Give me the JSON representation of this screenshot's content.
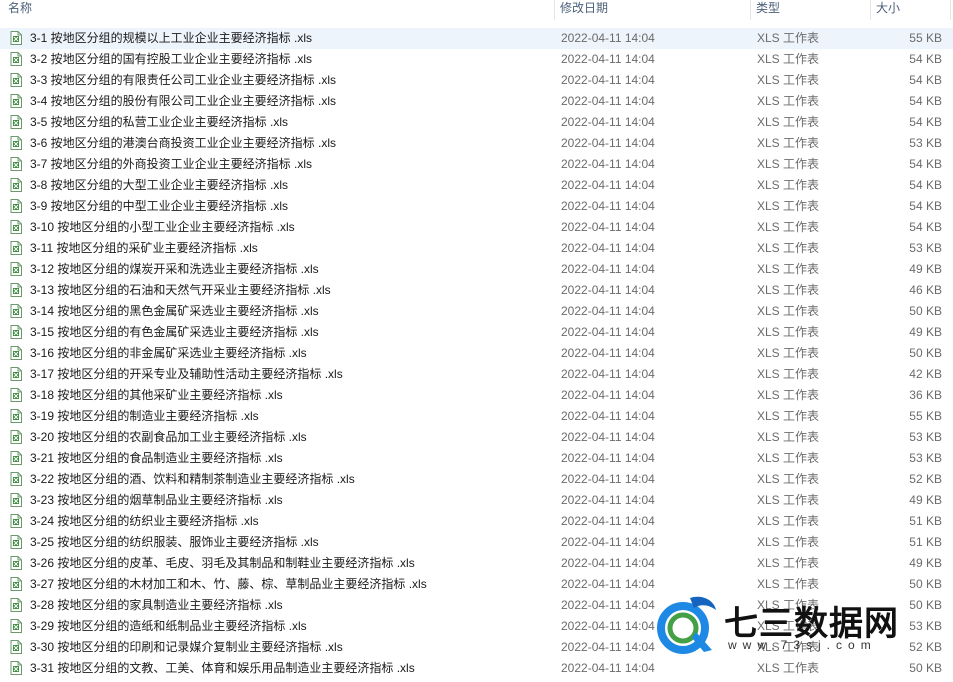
{
  "columns": {
    "name": "名称",
    "date": "修改日期",
    "type": "类型",
    "size": "大小"
  },
  "files": [
    {
      "name": "3-1 按地区分组的规模以上工业企业主要经济指标 .xls",
      "date": "2022-04-11 14:04",
      "type": "XLS 工作表",
      "size": "55 KB"
    },
    {
      "name": "3-2 按地区分组的国有控股工业企业主要经济指标 .xls",
      "date": "2022-04-11 14:04",
      "type": "XLS 工作表",
      "size": "54 KB"
    },
    {
      "name": "3-3 按地区分组的有限责任公司工业企业主要经济指标 .xls",
      "date": "2022-04-11 14:04",
      "type": "XLS 工作表",
      "size": "54 KB"
    },
    {
      "name": "3-4 按地区分组的股份有限公司工业企业主要经济指标 .xls",
      "date": "2022-04-11 14:04",
      "type": "XLS 工作表",
      "size": "54 KB"
    },
    {
      "name": "3-5 按地区分组的私营工业企业主要经济指标 .xls",
      "date": "2022-04-11 14:04",
      "type": "XLS 工作表",
      "size": "54 KB"
    },
    {
      "name": "3-6 按地区分组的港澳台商投资工业企业主要经济指标 .xls",
      "date": "2022-04-11 14:04",
      "type": "XLS 工作表",
      "size": "53 KB"
    },
    {
      "name": "3-7 按地区分组的外商投资工业企业主要经济指标 .xls",
      "date": "2022-04-11 14:04",
      "type": "XLS 工作表",
      "size": "54 KB"
    },
    {
      "name": "3-8 按地区分组的大型工业企业主要经济指标 .xls",
      "date": "2022-04-11 14:04",
      "type": "XLS 工作表",
      "size": "54 KB"
    },
    {
      "name": "3-9 按地区分组的中型工业企业主要经济指标 .xls",
      "date": "2022-04-11 14:04",
      "type": "XLS 工作表",
      "size": "54 KB"
    },
    {
      "name": "3-10 按地区分组的小型工业企业主要经济指标 .xls",
      "date": "2022-04-11 14:04",
      "type": "XLS 工作表",
      "size": "54 KB"
    },
    {
      "name": "3-11 按地区分组的采矿业主要经济指标 .xls",
      "date": "2022-04-11 14:04",
      "type": "XLS 工作表",
      "size": "53 KB"
    },
    {
      "name": "3-12 按地区分组的煤炭开采和洗选业主要经济指标 .xls",
      "date": "2022-04-11 14:04",
      "type": "XLS 工作表",
      "size": "49 KB"
    },
    {
      "name": "3-13 按地区分组的石油和天然气开采业主要经济指标 .xls",
      "date": "2022-04-11 14:04",
      "type": "XLS 工作表",
      "size": "46 KB"
    },
    {
      "name": "3-14 按地区分组的黑色金属矿采选业主要经济指标 .xls",
      "date": "2022-04-11 14:04",
      "type": "XLS 工作表",
      "size": "50 KB"
    },
    {
      "name": "3-15 按地区分组的有色金属矿采选业主要经济指标 .xls",
      "date": "2022-04-11 14:04",
      "type": "XLS 工作表",
      "size": "49 KB"
    },
    {
      "name": "3-16 按地区分组的非金属矿采选业主要经济指标 .xls",
      "date": "2022-04-11 14:04",
      "type": "XLS 工作表",
      "size": "50 KB"
    },
    {
      "name": "3-17 按地区分组的开采专业及辅助性活动主要经济指标 .xls",
      "date": "2022-04-11 14:04",
      "type": "XLS 工作表",
      "size": "42 KB"
    },
    {
      "name": "3-18 按地区分组的其他采矿业主要经济指标 .xls",
      "date": "2022-04-11 14:04",
      "type": "XLS 工作表",
      "size": "36 KB"
    },
    {
      "name": "3-19 按地区分组的制造业主要经济指标 .xls",
      "date": "2022-04-11 14:04",
      "type": "XLS 工作表",
      "size": "55 KB"
    },
    {
      "name": "3-20 按地区分组的农副食品加工业主要经济指标 .xls",
      "date": "2022-04-11 14:04",
      "type": "XLS 工作表",
      "size": "53 KB"
    },
    {
      "name": "3-21 按地区分组的食品制造业主要经济指标 .xls",
      "date": "2022-04-11 14:04",
      "type": "XLS 工作表",
      "size": "53 KB"
    },
    {
      "name": "3-22 按地区分组的酒、饮料和精制茶制造业主要经济指标 .xls",
      "date": "2022-04-11 14:04",
      "type": "XLS 工作表",
      "size": "52 KB"
    },
    {
      "name": "3-23 按地区分组的烟草制品业主要经济指标 .xls",
      "date": "2022-04-11 14:04",
      "type": "XLS 工作表",
      "size": "49 KB"
    },
    {
      "name": "3-24 按地区分组的纺织业主要经济指标 .xls",
      "date": "2022-04-11 14:04",
      "type": "XLS 工作表",
      "size": "51 KB"
    },
    {
      "name": "3-25 按地区分组的纺织服装、服饰业主要经济指标 .xls",
      "date": "2022-04-11 14:04",
      "type": "XLS 工作表",
      "size": "51 KB"
    },
    {
      "name": "3-26 按地区分组的皮革、毛皮、羽毛及其制品和制鞋业主要经济指标 .xls",
      "date": "2022-04-11 14:04",
      "type": "XLS 工作表",
      "size": "49 KB"
    },
    {
      "name": "3-27 按地区分组的木材加工和木、竹、藤、棕、草制品业主要经济指标 .xls",
      "date": "2022-04-11 14:04",
      "type": "XLS 工作表",
      "size": "50 KB"
    },
    {
      "name": "3-28 按地区分组的家具制造业主要经济指标 .xls",
      "date": "2022-04-11 14:04",
      "type": "XLS 工作表",
      "size": "50 KB"
    },
    {
      "name": "3-29 按地区分组的造纸和纸制品业主要经济指标 .xls",
      "date": "2022-04-11 14:04",
      "type": "XLS 工作表",
      "size": "53 KB"
    },
    {
      "name": "3-30 按地区分组的印刷和记录媒介复制业主要经济指标 .xls",
      "date": "2022-04-11 14:04",
      "type": "XLS 工作表",
      "size": "52 KB"
    },
    {
      "name": "3-31 按地区分组的文教、工美、体育和娱乐用品制造业主要经济指标 .xls",
      "date": "2022-04-11 14:04",
      "type": "XLS 工作表",
      "size": "50 KB"
    }
  ],
  "watermark": {
    "brand": "七三数据网",
    "url": "www.73sj.com"
  },
  "icons": {
    "file": "xls-file-icon"
  },
  "colors": {
    "selected_row": "#eef4fc",
    "icon_green": "#3c8b3f",
    "header_text": "#4c607a"
  }
}
